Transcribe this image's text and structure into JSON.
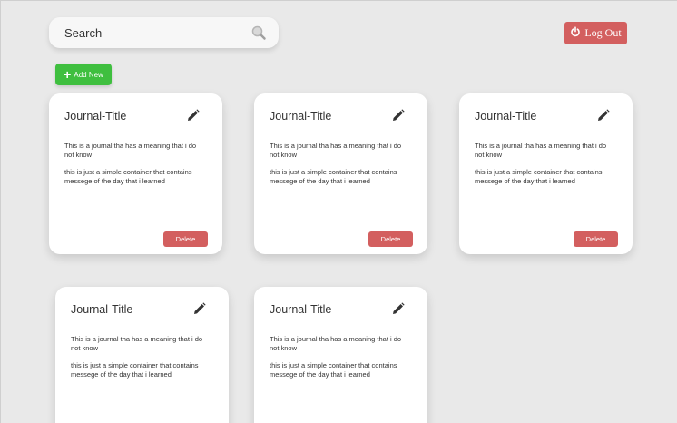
{
  "search": {
    "placeholder": "Search"
  },
  "header": {
    "logout_label": "Log Out",
    "add_label": "Add New"
  },
  "colors": {
    "background": "#e9e9e9",
    "danger": "#d35f5f",
    "success": "#3fbf3f"
  },
  "icons": {
    "search": "search-icon",
    "logout": "power-icon",
    "add": "plus-icon",
    "edit": "pencil-icon"
  },
  "cards": [
    {
      "title": "Journal-Title",
      "line1": "This is a journal tha has a meaning that i do not know",
      "line2": "this is just a simple container that contains messege of the day that i learned",
      "delete_label": "Delete"
    },
    {
      "title": "Journal-Title",
      "line1": "This is a journal tha has a meaning that i do not know",
      "line2": "this is just a simple container that contains messege of the day that i learned",
      "delete_label": "Delete"
    },
    {
      "title": "Journal-Title",
      "line1": "This is a journal tha has a meaning that i do not know",
      "line2": "this is just a simple container that contains messege of the day that i learned",
      "delete_label": "Delete"
    },
    {
      "title": "Journal-Title",
      "line1": "This is a journal tha has a meaning that i do not know",
      "line2": "this is just a simple container that contains messege of the day that i learned",
      "delete_label": ""
    },
    {
      "title": "Journal-Title",
      "line1": "This is a journal tha has a meaning that i do not know",
      "line2": "this is just a simple container that contains messege of the day that i learned",
      "delete_label": ""
    }
  ]
}
